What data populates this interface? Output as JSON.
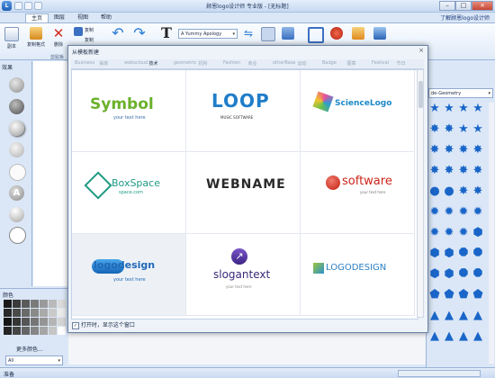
{
  "window": {
    "title": "顾恩logo设计师 专业版 - [无标题]",
    "app_icon_letter": "L"
  },
  "menu": {
    "tabs": [
      "主页",
      "图层",
      "视图",
      "帮助"
    ],
    "active_tab": "主页",
    "help_link": "了解顾恩logo设计师"
  },
  "ribbon": {
    "buttons": [
      {
        "label": "副本",
        "icon": "copy-icon"
      },
      {
        "label": "复制格式",
        "icon": "brush-icon"
      },
      {
        "label": "删除",
        "icon": "delete-icon"
      }
    ],
    "small_buttons": [
      "复制",
      "复制"
    ],
    "group_label": "剪贴板",
    "font_value": "A Yummy Apology"
  },
  "left_panel": {
    "header": "效果",
    "effects": [
      "circle-gray",
      "circle-dark",
      "circle-shadow",
      "circle-light",
      "circle-white",
      "letter-A",
      "circle-gloss",
      "circle-outline"
    ]
  },
  "color_panel": {
    "header": "颜色",
    "more_colors": "更多颜色...",
    "select_value": "All",
    "swatches": [
      "#1a1a1a",
      "#3a3a3a",
      "#5a5a5a",
      "#7a7a7a",
      "#9a9a9a",
      "#bababa",
      "#dadada",
      "#2a2a2a",
      "#4a4a4a",
      "#6a6a6a",
      "#8a8a8a",
      "#aaaaaa",
      "#cacaca",
      "#eaeaea",
      "#151515",
      "#353535",
      "#555555",
      "#757575",
      "#959595",
      "#b5b5b5",
      "#d5d5d5",
      "#252525",
      "#454545",
      "#656565",
      "#858585",
      "#a5a5a5",
      "#c5c5c5",
      "#ffffff"
    ]
  },
  "right_panel": {
    "select_value": "de-Geometry",
    "shapes": [
      "star",
      "star",
      "star",
      "star",
      "burst",
      "burst",
      "star",
      "star",
      "burst",
      "burst",
      "burst",
      "burst",
      "burst",
      "burst",
      "burst",
      "burst",
      "circle",
      "circle",
      "burst",
      "burst",
      "gear",
      "gear",
      "gear",
      "gear",
      "gear",
      "gear",
      "gear",
      "hex",
      "hex",
      "hex",
      "oct",
      "oct",
      "hex",
      "hex",
      "oct",
      "oct",
      "pent",
      "pent",
      "pent",
      "pent",
      "tri",
      "tri",
      "tri",
      "tri",
      "tri",
      "tri",
      "tri",
      "tri"
    ]
  },
  "dialog": {
    "title": "从模板新建",
    "close": "×",
    "categories": [
      "Business",
      "抽象",
      "webscloud",
      "技术",
      "geometric",
      "机构",
      "Fashion",
      "商业",
      "otherBase",
      "运动",
      "Badge",
      "图章",
      "Festival",
      "节日"
    ],
    "active_category": "技术",
    "templates": [
      {
        "name": "Symbol",
        "tag": "your text here"
      },
      {
        "name": "LOOP",
        "tag": "MUSIC SOFTWARE"
      },
      {
        "name": "ScienceLogo",
        "tag": ""
      },
      {
        "name": "BoxSpace",
        "tag": "space.com"
      },
      {
        "name": "WEBNAME",
        "tag": ""
      },
      {
        "name": "software",
        "tag": "your text here"
      },
      {
        "name": "logodesign",
        "tag": "your text here"
      },
      {
        "name": "slogantext",
        "tag": "your text here"
      },
      {
        "name": "LOGODESIGN",
        "tag": ""
      }
    ],
    "footer_checkbox": "打开时，显示这个窗口",
    "footer_checked": true
  },
  "status": {
    "text": "准备"
  }
}
